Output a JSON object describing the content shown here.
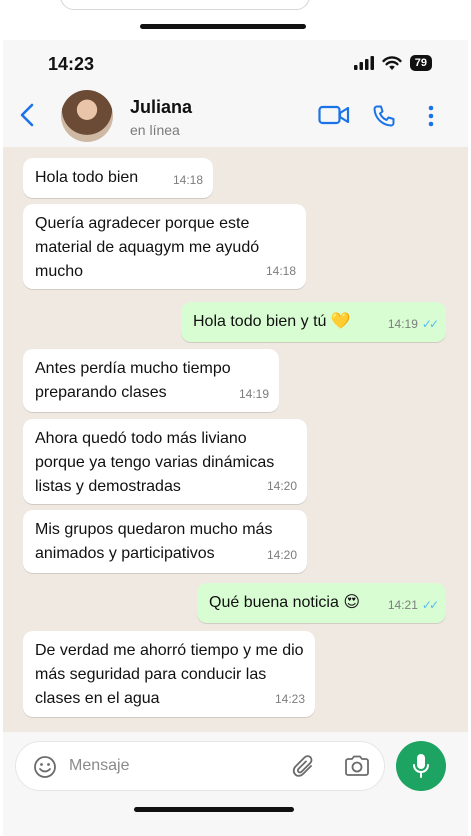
{
  "status_bar": {
    "time": "14:23",
    "battery": "79"
  },
  "header": {
    "contact_name": "Juliana",
    "contact_status": "en línea"
  },
  "messages": [
    {
      "dir": "in",
      "text": "Hola todo bien",
      "time": "14:18"
    },
    {
      "dir": "in",
      "text": "Quería agradecer porque este material de aquagym me ayudó mucho",
      "time": "14:18"
    },
    {
      "dir": "out",
      "text": "Hola todo bien y tú 💛",
      "time": "14:19"
    },
    {
      "dir": "in",
      "text": "Antes perdía mucho tiempo preparando clases",
      "time": "14:19"
    },
    {
      "dir": "in",
      "text": "Ahora quedó todo más liviano porque ya tengo varias dinámicas listas y demostradas",
      "time": "14:20"
    },
    {
      "dir": "in",
      "text": "Mis grupos quedaron mucho más animados y participativos",
      "time": "14:20"
    },
    {
      "dir": "out",
      "text": "Qué buena noticia 😍",
      "time": "14:21"
    },
    {
      "dir": "in",
      "text": "De verdad me ahorró tiempo y me dio más seguridad para conducir las clases en el agua",
      "time": "14:23"
    }
  ],
  "composer": {
    "placeholder": "Mensaje"
  },
  "colors": {
    "accent": "#1a73e8",
    "mic": "#1da462",
    "outgoing_bubble": "#d9fdd3",
    "read_ticks": "#53bdeb"
  }
}
